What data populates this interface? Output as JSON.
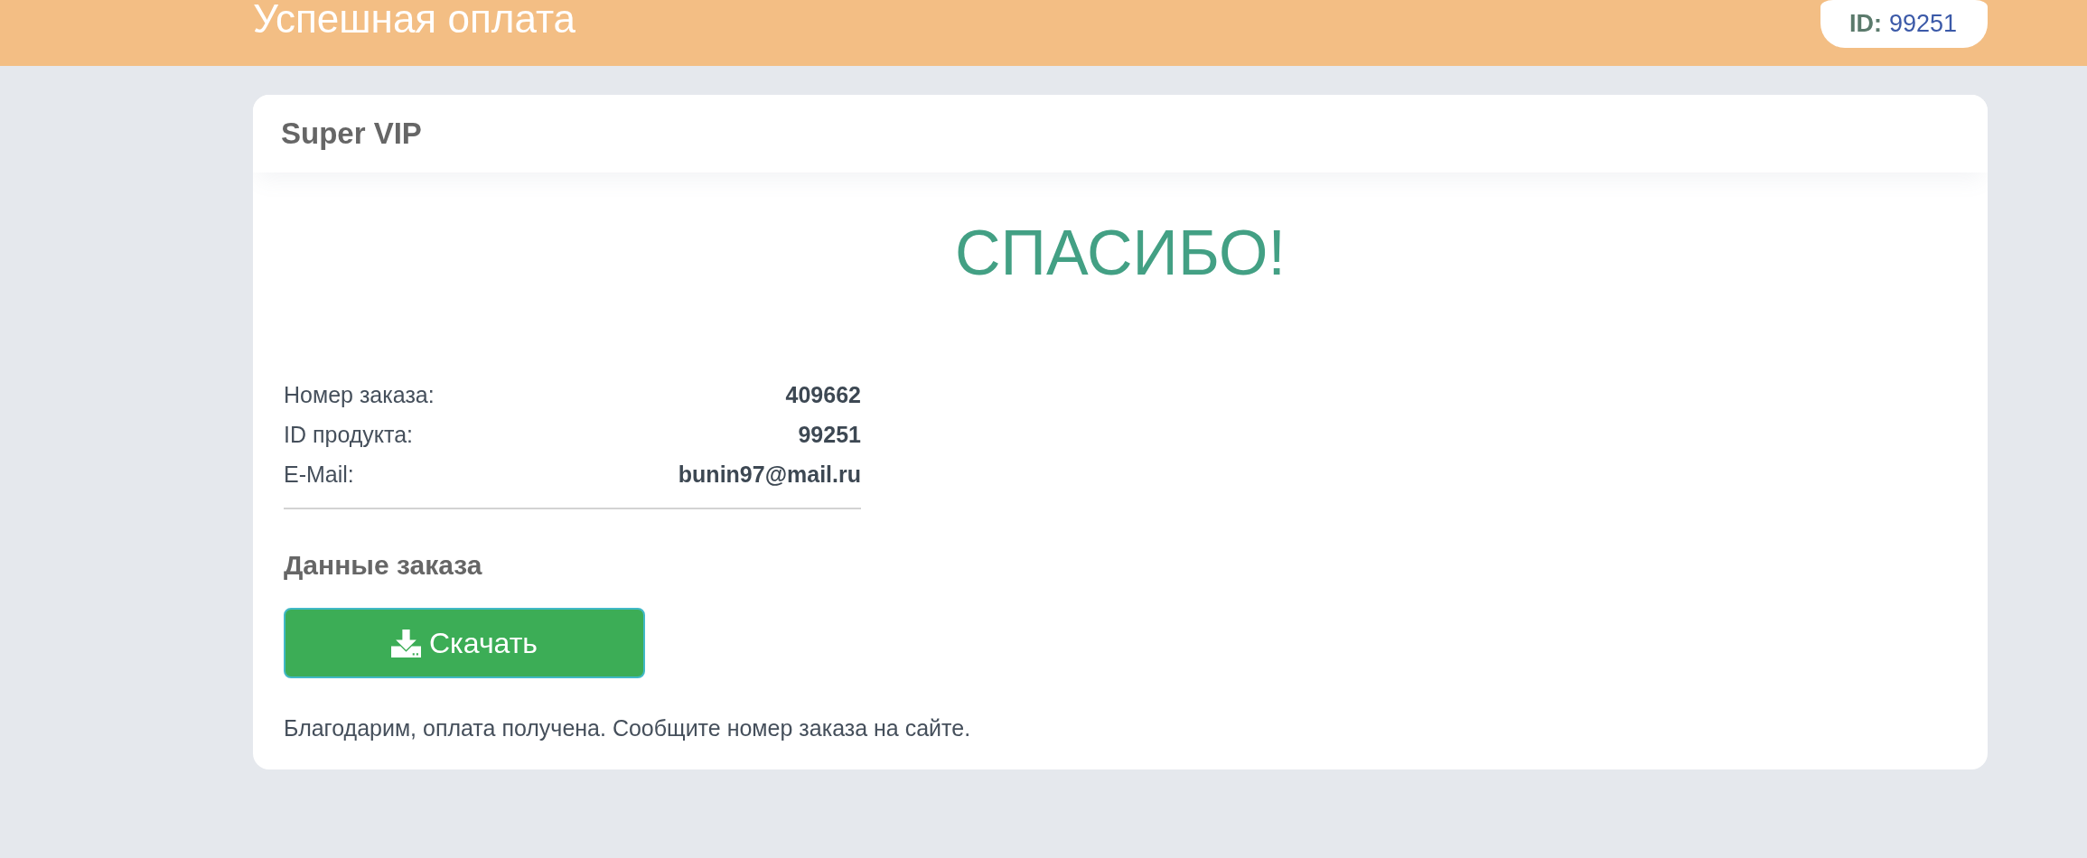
{
  "header": {
    "title": "Успешная оплата",
    "id_label": "ID:",
    "id_value": "99251"
  },
  "card": {
    "title": "Super VIP",
    "heading": "СПАСИБО!",
    "details": [
      {
        "label": "Номер заказа:",
        "value": "409662"
      },
      {
        "label": "ID продукта:",
        "value": "99251"
      },
      {
        "label": "E-Mail:",
        "value": "bunin97@mail.ru"
      }
    ],
    "section_title": "Данные заказа",
    "download_button": {
      "label": "Скачать"
    },
    "note": "Благодарим, оплата получена. Сообщите номер заказа на сайте."
  }
}
